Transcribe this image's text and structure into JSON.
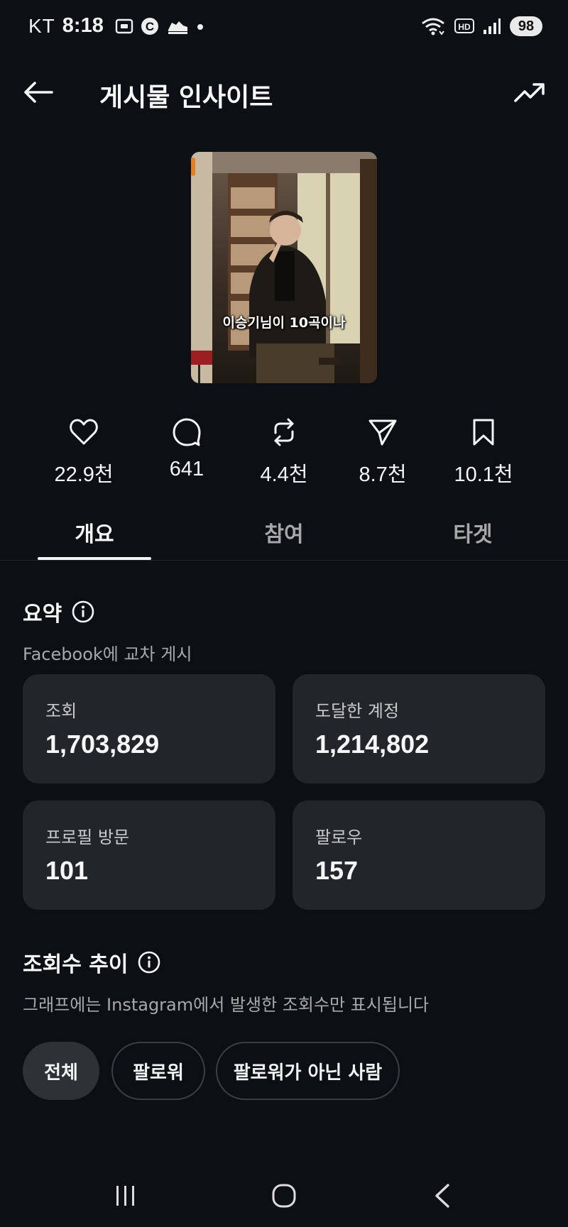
{
  "status_bar": {
    "carrier": "KT",
    "time": "8:18",
    "battery": "98",
    "network_badge": "HD",
    "icons": [
      "screenshot-icon",
      "c-badge-icon",
      "shoe-icon",
      "dot-icon",
      "wifi-icon",
      "hd-icon",
      "signal-icon"
    ]
  },
  "header": {
    "title": "게시물 인사이트",
    "back_icon": "arrow-left-icon",
    "trend_icon": "trending-up-icon"
  },
  "thumbnail": {
    "caption": "이승기님이 10곡이나"
  },
  "stats": [
    {
      "icon": "heart-icon",
      "value": "22.9천"
    },
    {
      "icon": "comment-icon",
      "value": "641"
    },
    {
      "icon": "repost-icon",
      "value": "4.4천"
    },
    {
      "icon": "share-icon",
      "value": "8.7천"
    },
    {
      "icon": "bookmark-icon",
      "value": "10.1천"
    }
  ],
  "tabs": [
    {
      "label": "개요",
      "active": true
    },
    {
      "label": "참여",
      "active": false
    },
    {
      "label": "타겟",
      "active": false
    }
  ],
  "summary": {
    "title": "요약",
    "subtitle": "Facebook에 교차 게시",
    "cards": [
      {
        "label": "조회",
        "value": "1,703,829"
      },
      {
        "label": "도달한 계정",
        "value": "1,214,802"
      },
      {
        "label": "프로필 방문",
        "value": "101"
      },
      {
        "label": "팔로우",
        "value": "157"
      }
    ]
  },
  "views_trend": {
    "title": "조회수 추이",
    "subtitle": "그래프에는 Instagram에서 발생한 조회수만 표시됩니다",
    "filters": [
      {
        "label": "전체",
        "selected": true
      },
      {
        "label": "팔로워",
        "selected": false
      },
      {
        "label": "팔로워가 아닌 사람",
        "selected": false
      }
    ]
  },
  "nav_bar": {
    "icons": [
      "recent-apps-icon",
      "home-icon",
      "back-icon"
    ]
  },
  "colors": {
    "background": "#0c1014",
    "card": "#22262b",
    "text_primary": "#f7f7f7",
    "text_secondary": "#a8a8a8"
  }
}
